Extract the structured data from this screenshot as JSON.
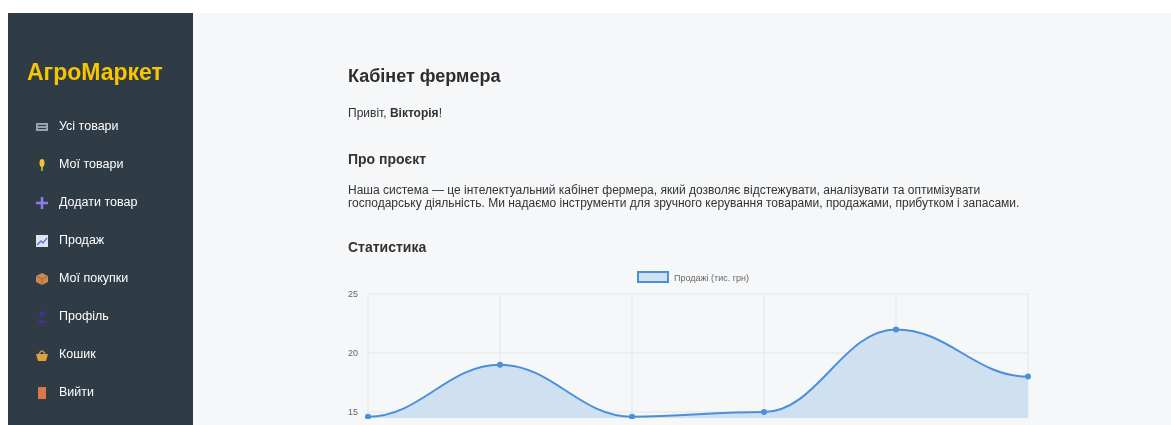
{
  "sidebar": {
    "logo": "АгроМаркет",
    "items": [
      {
        "label": "Усі товари"
      },
      {
        "label": "Мої товари"
      },
      {
        "label": "Додати товар"
      },
      {
        "label": "Продаж"
      },
      {
        "label": "Мої покупки"
      },
      {
        "label": "Профіль"
      },
      {
        "label": "Кошик"
      },
      {
        "label": "Вийти"
      }
    ]
  },
  "main": {
    "title": "Кабінет фермера",
    "greeting": "Привіт, **Вікторія**!",
    "about": {
      "heading": "Про проєкт",
      "text": "Наша система — це інтелектуальний кабінет фермера, який дозволяє відстежувати, аналізувати та оптимізувати господарську діяльність. Ми надаємо інструменти для зручного керування товарами, продажами, прибутком і запасами."
    },
    "stats": {
      "heading": "Статистика",
      "chart_data": {
        "type": "area",
        "grid": true,
        "ylim": [
          14.5,
          25
        ],
        "yticks": [
          15,
          20,
          25
        ],
        "series": [
          {
            "name": "Продажі (тис. грн)",
            "color": "#4a90d9",
            "values": [
              14.6,
              19,
              14.6,
              15,
              22,
              18
            ]
          }
        ]
      }
    }
  }
}
